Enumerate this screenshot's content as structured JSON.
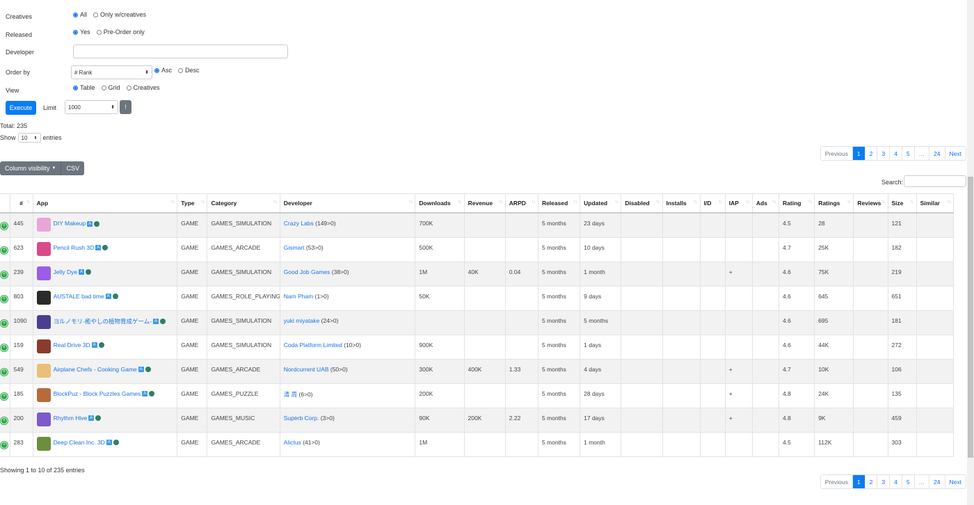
{
  "form": {
    "creatives": {
      "label": "Creatives",
      "opt1": "All",
      "opt2": "Only w/creatives"
    },
    "released": {
      "label": "Released",
      "opt1": "Yes",
      "opt2": "Pre-Order only"
    },
    "developer": {
      "label": "Developer",
      "value": ""
    },
    "order_by": {
      "label": "Order by",
      "value": "# Rank",
      "asc": "Asc",
      "desc": "Desc"
    },
    "view": {
      "label": "View",
      "opt1": "Table",
      "opt2": "Grid",
      "opt3": "Creatives"
    },
    "execute_label": "Execute",
    "limit_label": "Limit",
    "limit_value": "1000",
    "info_button": "!"
  },
  "summary": {
    "total": "Total: 235",
    "show_label": "Show",
    "show_value": "10",
    "entries_label": "entries"
  },
  "toolbar": {
    "column_visibility": "Column visibility",
    "csv": "CSV"
  },
  "search_label": "Search:",
  "pagination": [
    "Previous",
    "1",
    "2",
    "3",
    "4",
    "5",
    "…",
    "24",
    "Next"
  ],
  "columns": [
    "#",
    "App",
    "Type",
    "Category",
    "Developer",
    "Downloads",
    "Revenue",
    "ARPD",
    "Released",
    "Updated",
    "Disabled",
    "Installs",
    "I/D",
    "IAP",
    "Ads",
    "Rating",
    "Ratings",
    "Reviews",
    "Size",
    "Similar"
  ],
  "rows": [
    {
      "rank": "445",
      "app": "DIY Makeup",
      "type": "GAME",
      "category": "GAMES_SIMULATION",
      "dev": "Crazy Labs",
      "dev_count": "(149>0)",
      "downloads": "700K",
      "revenue": "",
      "arpd": "",
      "released": "5 months",
      "updated": "23 days",
      "iap": "",
      "rating": "4.5",
      "ratings": "28",
      "size": "121"
    },
    {
      "rank": "623",
      "app": "Pencil Rush 3D",
      "type": "GAME",
      "category": "GAMES_ARCADE",
      "dev": "Gismart",
      "dev_count": "(53>0)",
      "downloads": "500K",
      "revenue": "",
      "arpd": "",
      "released": "5 months",
      "updated": "10 days",
      "iap": "",
      "rating": "4.7",
      "ratings": "25K",
      "size": "182"
    },
    {
      "rank": "239",
      "app": "Jelly Dye",
      "type": "GAME",
      "category": "GAMES_SIMULATION",
      "dev": "Good Job Games",
      "dev_count": "(38>0)",
      "downloads": "1M",
      "revenue": "40K",
      "arpd": "0.04",
      "released": "5 months",
      "updated": "1 month",
      "iap": "+",
      "rating": "4.6",
      "ratings": "75K",
      "size": "219"
    },
    {
      "rank": "803",
      "app": "AUSTALE bad time",
      "type": "GAME",
      "category": "GAMES_ROLE_PLAYING",
      "dev": "Nam Pham",
      "dev_count": "(1>0)",
      "downloads": "50K",
      "revenue": "",
      "arpd": "",
      "released": "5 months",
      "updated": "9 days",
      "iap": "",
      "rating": "4.6",
      "ratings": "645",
      "size": "651"
    },
    {
      "rank": "1090",
      "app": "ヨルノモリ-癒やしの植物育成ゲーム-",
      "type": "GAME",
      "category": "GAMES_SIMULATION",
      "dev": "yuki miyatake",
      "dev_count": "(24>0)",
      "downloads": "",
      "revenue": "",
      "arpd": "",
      "released": "5 months",
      "updated": "5 months",
      "iap": "",
      "rating": "4.6",
      "ratings": "695",
      "size": "181"
    },
    {
      "rank": "159",
      "app": "Real Drive 3D",
      "type": "GAME",
      "category": "GAMES_SIMULATION",
      "dev": "Coda Platform Limited",
      "dev_count": "(10>0)",
      "downloads": "900K",
      "revenue": "",
      "arpd": "",
      "released": "5 months",
      "updated": "1 days",
      "iap": "",
      "rating": "4.6",
      "ratings": "44K",
      "size": "272"
    },
    {
      "rank": "549",
      "app": "Airplane Chefs - Cooking Game",
      "type": "GAME",
      "category": "GAMES_ARCADE",
      "dev": "Nordcurrent UAB",
      "dev_count": "(50>0)",
      "downloads": "300K",
      "revenue": "400K",
      "arpd": "1.33",
      "released": "5 months",
      "updated": "4 days",
      "iap": "+",
      "rating": "4.7",
      "ratings": "10K",
      "size": "106"
    },
    {
      "rank": "185",
      "app": "BlockPuz - Block Puzzles Games",
      "type": "GAME",
      "category": "GAMES_PUZZLE",
      "dev": "清 周",
      "dev_count": "(6>0)",
      "downloads": "200K",
      "revenue": "",
      "arpd": "",
      "released": "5 months",
      "updated": "28 days",
      "iap": "+",
      "rating": "4.8",
      "ratings": "24K",
      "size": "135"
    },
    {
      "rank": "200",
      "app": "Rhythm Hive",
      "type": "GAME",
      "category": "GAMES_MUSIC",
      "dev": "Superb Corp.",
      "dev_count": "(3>0)",
      "downloads": "90K",
      "revenue": "200K",
      "arpd": "2.22",
      "released": "5 months",
      "updated": "17 days",
      "iap": "+",
      "rating": "4.8",
      "ratings": "9K",
      "size": "459"
    },
    {
      "rank": "283",
      "app": "Deep Clean Inc. 3D",
      "type": "GAME",
      "category": "GAMES_ARCADE",
      "dev": "Alictus",
      "dev_count": "(41>0)",
      "downloads": "1M",
      "revenue": "",
      "arpd": "",
      "released": "5 months",
      "updated": "1 month",
      "iap": "",
      "rating": "4.5",
      "ratings": "112K",
      "size": "303"
    }
  ],
  "thumb_colors": [
    "#e8a6d8",
    "#d94a8c",
    "#9b5de5",
    "#2b2b2b",
    "#4a3f8f",
    "#8a3b2e",
    "#e8c07a",
    "#b86b3a",
    "#7a5cc9",
    "#6b8f3c"
  ],
  "footer_info": "Showing 1 to 10 of 235 entries"
}
